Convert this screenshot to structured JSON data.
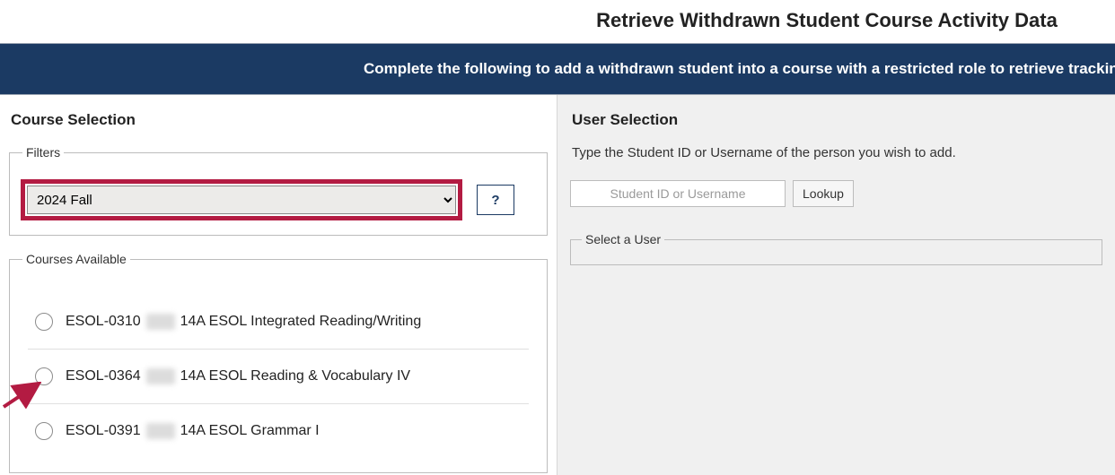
{
  "page": {
    "title": "Retrieve Withdrawn Student Course Activity Data",
    "banner": "Complete the following to add a withdrawn student into a course with a restricted role to retrieve tracking data, subm"
  },
  "left": {
    "heading": "Course Selection",
    "filters_legend": "Filters",
    "term_selected": "2024 Fall",
    "help_label": "?",
    "courses_legend": "Courses Available",
    "courses": [
      {
        "code": "ESOL-0310",
        "suffix": "14A ESOL Integrated Reading/Writing"
      },
      {
        "code": "ESOL-0364",
        "suffix": "14A ESOL Reading & Vocabulary IV"
      },
      {
        "code": "ESOL-0391",
        "suffix": "14A ESOL Grammar I"
      }
    ]
  },
  "right": {
    "heading": "User Selection",
    "instruction": "Type the Student ID or Username of the person you wish to add.",
    "input_placeholder": "Student ID or Username",
    "lookup_label": "Lookup",
    "select_user_legend": "Select a User"
  }
}
